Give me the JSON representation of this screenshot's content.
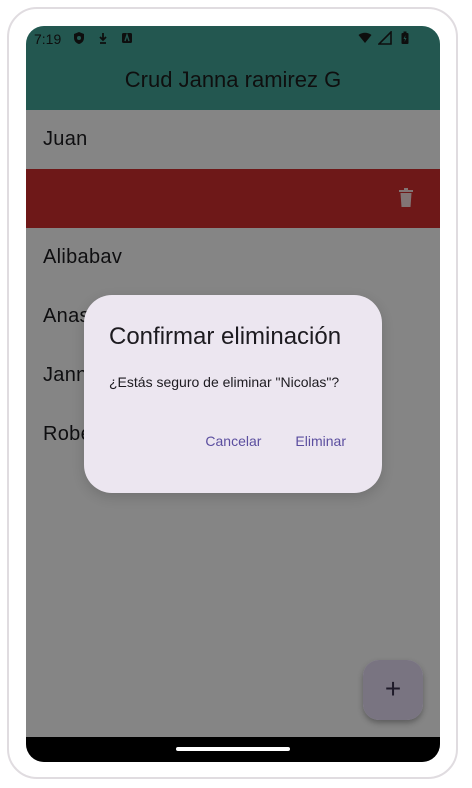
{
  "status_bar": {
    "time": "7:19",
    "left_icons": [
      "shield-icon",
      "download-icon",
      "app-badge-icon"
    ],
    "right_icons": [
      "wifi-icon",
      "signal-icon",
      "battery-icon"
    ]
  },
  "app_bar": {
    "title": "Crud Janna ramirez G",
    "color": "#43a89a"
  },
  "list": {
    "items": [
      {
        "label": "Juan"
      },
      {
        "label": ""
      },
      {
        "label": "Alibabav"
      },
      {
        "label": "Anas"
      },
      {
        "label": "Jann"
      },
      {
        "label": "Robe"
      }
    ],
    "delete_background": "#d32f2f"
  },
  "dialog": {
    "title": "Confirmar eliminación",
    "message": "¿Estás seguro de eliminar \"Nicolas\"?",
    "cancel_label": "Cancelar",
    "confirm_label": "Eliminar",
    "accent_color": "#5b4e9f"
  },
  "fab": {
    "icon": "plus-icon",
    "glyph": "+"
  }
}
